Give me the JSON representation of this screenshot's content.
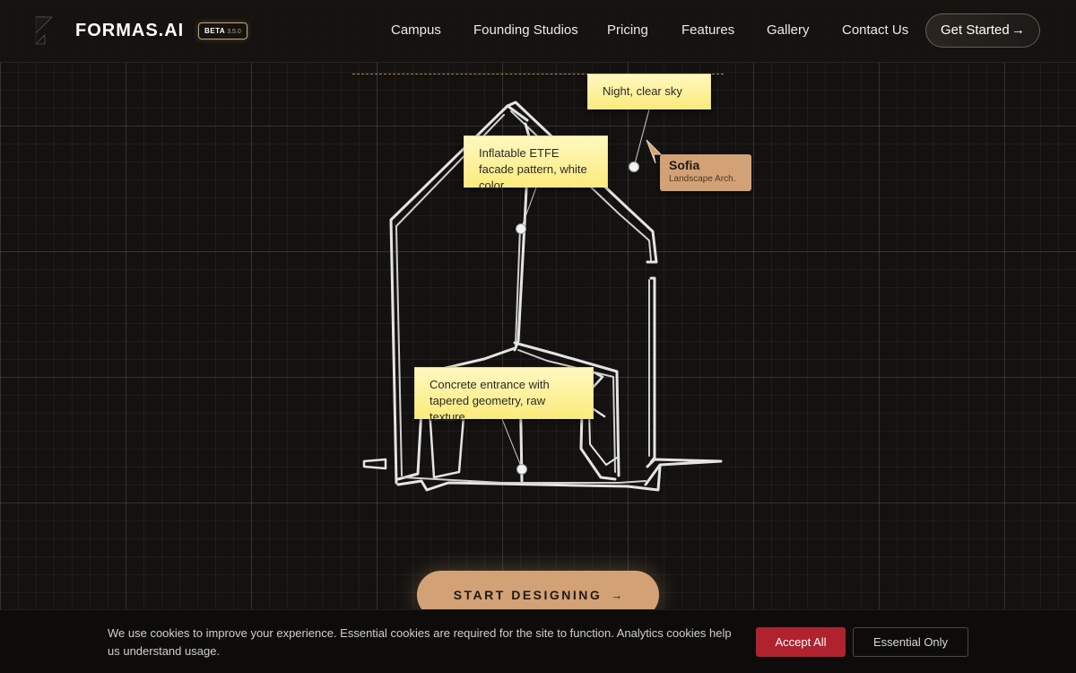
{
  "header": {
    "brand": "FORMAS.AI",
    "beta_tag": "BETA",
    "version": "3.5.0",
    "nav": [
      {
        "label": "Campus"
      },
      {
        "label": "Founding Studios"
      },
      {
        "label": "Pricing"
      },
      {
        "label": "Features"
      },
      {
        "label": "Gallery"
      },
      {
        "label": "Contact Us"
      }
    ],
    "cta_label": "Get Started",
    "cta_icon": "arrow-right-icon"
  },
  "canvas": {
    "notes": {
      "sky": "Night, clear sky",
      "facade": "Inflatable ETFE facade pattern, white color",
      "concrete": "Concrete entrance with tapered geometry, raw texture"
    },
    "collaborator": {
      "name": "Sofia",
      "role": "Landscape Arch."
    }
  },
  "hero": {
    "start_label": "START DESIGNING",
    "start_icon": "arrow-right-icon"
  },
  "cookie_banner": {
    "text": "We use cookies to improve your experience. Essential cookies are required for the site to function. Analytics cookies help us understand usage.",
    "accept_label": "Accept All",
    "essential_label": "Essential Only"
  },
  "colors": {
    "accent": "#d2a276",
    "note_yellow": "#fbeb7c",
    "accept_red": "#b0232e",
    "background": "#141210"
  }
}
